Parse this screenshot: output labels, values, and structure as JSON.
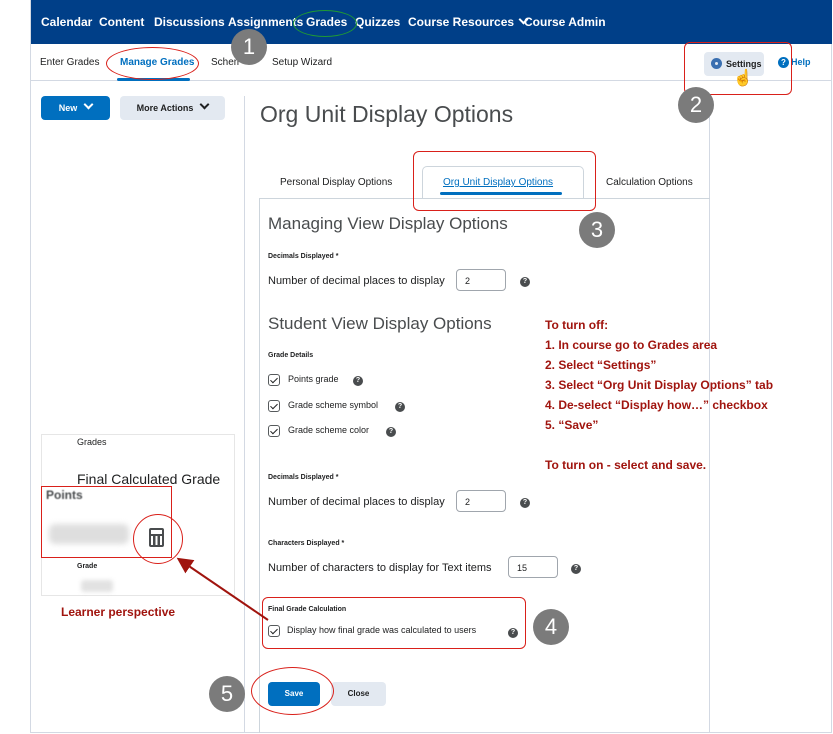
{
  "topnav": {
    "items": [
      "Calendar",
      "Content",
      "Discussions",
      "Assignments",
      "Grades",
      "Quizzes",
      "Course Resources",
      "Course Admin"
    ]
  },
  "subnav": {
    "items": [
      "Enter Grades",
      "Manage Grades",
      "Schemes",
      "Setup Wizard"
    ],
    "active": "Manage Grades",
    "settings_label": "Settings",
    "help_label": "Help"
  },
  "actions": {
    "new_label": "New",
    "more_label": "More Actions"
  },
  "page": {
    "title": "Org Unit Display Options",
    "tabs": [
      "Personal Display Options",
      "Org Unit Display Options",
      "Calculation Options"
    ],
    "active_tab": "Org Unit Display Options"
  },
  "managing_view": {
    "heading": "Managing View Display Options",
    "decimals_label": "Decimals Displayed *",
    "decimals_text": "Number of decimal places to display",
    "decimals_value": "2"
  },
  "student_view": {
    "heading": "Student View Display Options",
    "grade_details_label": "Grade Details",
    "checkboxes": [
      "Points grade",
      "Grade scheme symbol",
      "Grade scheme color"
    ],
    "decimals_label": "Decimals Displayed *",
    "decimals_text": "Number of decimal places to display",
    "decimals_value": "2",
    "chars_label": "Characters Displayed *",
    "chars_text": "Number of characters to display for Text items",
    "chars_value": "15"
  },
  "final_calc": {
    "label": "Final Grade Calculation",
    "checkbox": "Display how final grade was calculated to users"
  },
  "buttons": {
    "save": "Save",
    "close": "Close"
  },
  "instructions": {
    "heading": "To turn off:",
    "steps": [
      "1. In course go to Grades area",
      "2. Select “Settings”",
      "3. Select “Org Unit Display Options” tab",
      "4. De-select “Display how…” checkbox",
      "5. “Save”"
    ],
    "turn_on": "To turn on - select and save."
  },
  "learner": {
    "grades_label": "Grades",
    "final_title": "Final Calculated Grade",
    "points_label": "Points",
    "grade_label": "Grade",
    "caption": "Learner perspective"
  },
  "step_numbers": [
    "1",
    "2",
    "3",
    "4",
    "5"
  ],
  "colors": {
    "nav_bg": "#003f88",
    "primary": "#006fbf",
    "annotation_red": "#d9201a",
    "instruction_text": "#a0140e",
    "green_highlight": "#1f9a34"
  }
}
